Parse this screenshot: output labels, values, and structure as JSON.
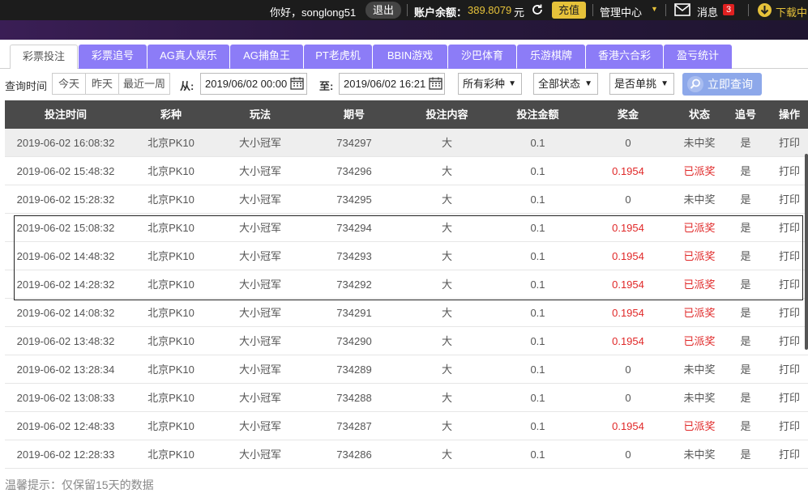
{
  "topbar": {
    "greeting": "你好，songlong51",
    "logout": "退出",
    "balance_label": "账户余额：",
    "balance_value": "389.8079",
    "currency": "元",
    "recharge": "充值",
    "management": "管理中心",
    "messages": "消息",
    "message_count": "3",
    "download": "下载中"
  },
  "tabs": [
    {
      "label": "彩票投注",
      "active": true
    },
    {
      "label": "彩票追号"
    },
    {
      "label": "AG真人娱乐"
    },
    {
      "label": "AG捕鱼王"
    },
    {
      "label": "PT老虎机"
    },
    {
      "label": "BBIN游戏"
    },
    {
      "label": "沙巴体育"
    },
    {
      "label": "乐游棋牌"
    },
    {
      "label": "香港六合彩"
    },
    {
      "label": "盈亏统计"
    }
  ],
  "filters": {
    "query_time_label": "查询时间",
    "today": "今天",
    "yesterday": "昨天",
    "last_week": "最近一周",
    "from_label": "从:",
    "from_value": "2019/06/02 00:00",
    "to_label": "至:",
    "to_value": "2019/06/02 16:21",
    "lottery_select": "所有彩种",
    "status_select": "全部状态",
    "single_select": "是否单挑",
    "search_button": "立即查询"
  },
  "table": {
    "headers": [
      "投注时间",
      "彩种",
      "玩法",
      "期号",
      "投注内容",
      "投注金额",
      "奖金",
      "状态",
      "追号",
      "操作"
    ],
    "rows": [
      [
        "2019-06-02 16:08:32",
        "北京PK10",
        "大小冠军",
        "734297",
        "大",
        "0.1",
        "0",
        "未中奖",
        "是",
        "打印"
      ],
      [
        "2019-06-02 15:48:32",
        "北京PK10",
        "大小冠军",
        "734296",
        "大",
        "0.1",
        "0.1954",
        "已派奖",
        "是",
        "打印"
      ],
      [
        "2019-06-02 15:28:32",
        "北京PK10",
        "大小冠军",
        "734295",
        "大",
        "0.1",
        "0",
        "未中奖",
        "是",
        "打印"
      ],
      [
        "2019-06-02 15:08:32",
        "北京PK10",
        "大小冠军",
        "734294",
        "大",
        "0.1",
        "0.1954",
        "已派奖",
        "是",
        "打印"
      ],
      [
        "2019-06-02 14:48:32",
        "北京PK10",
        "大小冠军",
        "734293",
        "大",
        "0.1",
        "0.1954",
        "已派奖",
        "是",
        "打印"
      ],
      [
        "2019-06-02 14:28:32",
        "北京PK10",
        "大小冠军",
        "734292",
        "大",
        "0.1",
        "0.1954",
        "已派奖",
        "是",
        "打印"
      ],
      [
        "2019-06-02 14:08:32",
        "北京PK10",
        "大小冠军",
        "734291",
        "大",
        "0.1",
        "0.1954",
        "已派奖",
        "是",
        "打印"
      ],
      [
        "2019-06-02 13:48:32",
        "北京PK10",
        "大小冠军",
        "734290",
        "大",
        "0.1",
        "0.1954",
        "已派奖",
        "是",
        "打印"
      ],
      [
        "2019-06-02 13:28:34",
        "北京PK10",
        "大小冠军",
        "734289",
        "大",
        "0.1",
        "0",
        "未中奖",
        "是",
        "打印"
      ],
      [
        "2019-06-02 13:08:33",
        "北京PK10",
        "大小冠军",
        "734288",
        "大",
        "0.1",
        "0",
        "未中奖",
        "是",
        "打印"
      ],
      [
        "2019-06-02 12:48:33",
        "北京PK10",
        "大小冠军",
        "734287",
        "大",
        "0.1",
        "0.1954",
        "已派奖",
        "是",
        "打印"
      ],
      [
        "2019-06-02 12:28:33",
        "北京PK10",
        "大小冠军",
        "734286",
        "大",
        "0.1",
        "0",
        "未中奖",
        "是",
        "打印"
      ]
    ]
  },
  "tip": "温馨提示：仅保留15天的数据",
  "colors": {
    "tab_purple": "#8c7cf7",
    "header_dark": "#4a4a4a",
    "win_red": "#e02828",
    "gold": "#e6c23a"
  }
}
